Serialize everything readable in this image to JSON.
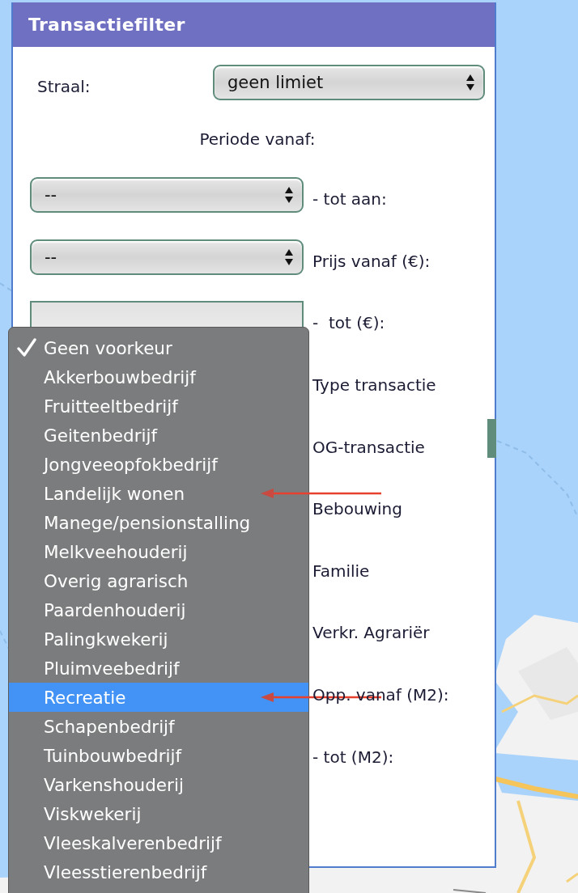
{
  "panel": {
    "title": "Transactiefilter"
  },
  "radius": {
    "label": "Straal:",
    "value": "geen limiet"
  },
  "period_heading": "Periode vanaf:",
  "rows": [
    {
      "kind": "select",
      "value": "--",
      "label": "- tot aan:"
    },
    {
      "kind": "select",
      "value": "--",
      "label": "Prijs vanaf (€):"
    },
    {
      "kind": "input",
      "label": "-  tot (€):"
    },
    {
      "kind": "blank",
      "label": "Type transactie"
    },
    {
      "kind": "blank",
      "label": "OG-transactie"
    },
    {
      "kind": "blank",
      "label": "Bebouwing"
    },
    {
      "kind": "blank",
      "label": "Familie"
    },
    {
      "kind": "blank",
      "label": "Verkr. Agrariër"
    },
    {
      "kind": "blank",
      "label": "Opp. vanaf (M2):"
    },
    {
      "kind": "blank",
      "label": "- tot (M2):"
    }
  ],
  "dropdown": {
    "options": [
      {
        "label": "Geen voorkeur",
        "checked": true,
        "selected": false,
        "arrow": false
      },
      {
        "label": "Akkerbouwbedrijf",
        "checked": false,
        "selected": false,
        "arrow": false
      },
      {
        "label": "Fruitteeltbedrijf",
        "checked": false,
        "selected": false,
        "arrow": false
      },
      {
        "label": "Geitenbedrijf",
        "checked": false,
        "selected": false,
        "arrow": false
      },
      {
        "label": "Jongveeopfokbedrijf",
        "checked": false,
        "selected": false,
        "arrow": false
      },
      {
        "label": "Landelijk wonen",
        "checked": false,
        "selected": false,
        "arrow": true
      },
      {
        "label": "Manege/pensionstalling",
        "checked": false,
        "selected": false,
        "arrow": false
      },
      {
        "label": "Melkveehouderij",
        "checked": false,
        "selected": false,
        "arrow": false
      },
      {
        "label": "Overig agrarisch",
        "checked": false,
        "selected": false,
        "arrow": false
      },
      {
        "label": "Paardenhouderij",
        "checked": false,
        "selected": false,
        "arrow": false
      },
      {
        "label": "Palingkwekerij",
        "checked": false,
        "selected": false,
        "arrow": false
      },
      {
        "label": "Pluimveebedrijf",
        "checked": false,
        "selected": false,
        "arrow": false
      },
      {
        "label": "Recreatie",
        "checked": false,
        "selected": true,
        "arrow": true
      },
      {
        "label": "Schapenbedrijf",
        "checked": false,
        "selected": false,
        "arrow": false
      },
      {
        "label": "Tuinbouwbedrijf",
        "checked": false,
        "selected": false,
        "arrow": false
      },
      {
        "label": "Varkenshouderij",
        "checked": false,
        "selected": false,
        "arrow": false
      },
      {
        "label": "Viskwekerij",
        "checked": false,
        "selected": false,
        "arrow": false
      },
      {
        "label": "Vleeskalverenbedrijf",
        "checked": false,
        "selected": false,
        "arrow": false
      },
      {
        "label": "Vleesstierenbedrijf",
        "checked": false,
        "selected": false,
        "arrow": false
      }
    ]
  }
}
